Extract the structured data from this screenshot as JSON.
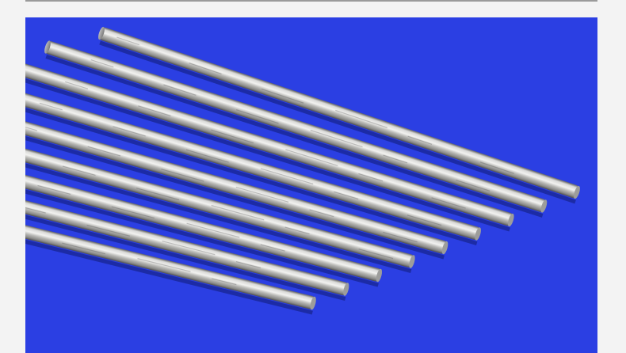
{
  "photo": {
    "subject": "aluminum-rods",
    "rod_count": 9,
    "colors": {
      "page_background": "#f3f3f3",
      "rule": "#9a9a9a",
      "backdrop": "#2b3fe3",
      "metal_light": "#e8e8e8",
      "metal_mid": "#b8b8b6",
      "metal_dark": "#6b6b6b"
    }
  }
}
